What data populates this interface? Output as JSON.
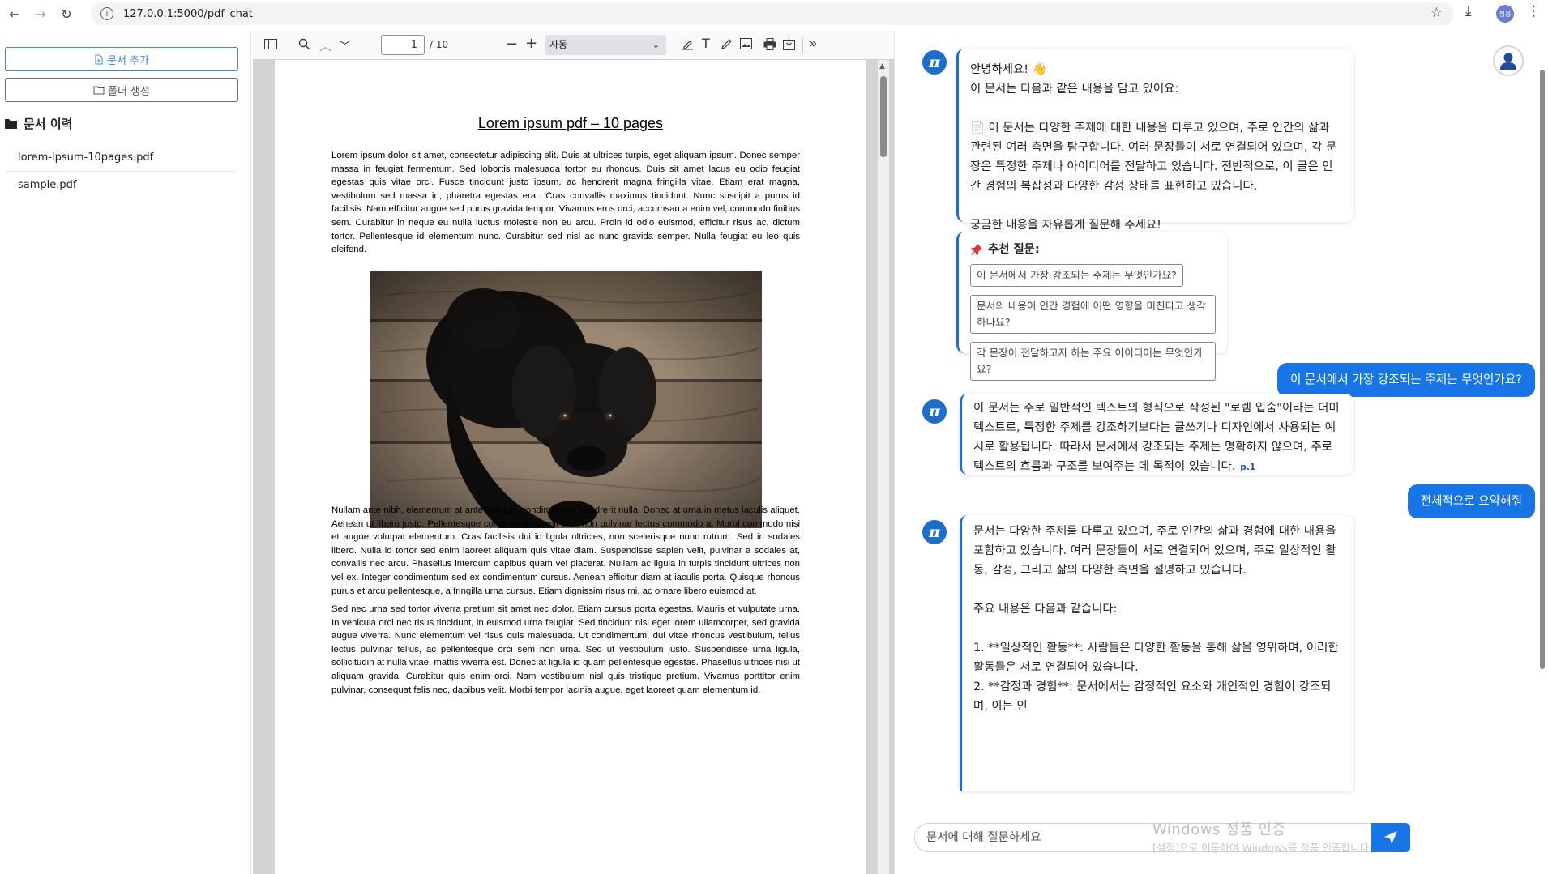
{
  "browser": {
    "url": "127.0.0.1:5000/pdf_chat",
    "profile_label": "정용"
  },
  "sidebar": {
    "add_doc_label": "문서 추가",
    "new_folder_label": "폴더 생성",
    "history_title": "문서 이력",
    "documents": [
      {
        "name": "lorem-ipsum-10pages.pdf"
      },
      {
        "name": "sample.pdf"
      }
    ]
  },
  "pdf_viewer": {
    "page_current": "1",
    "page_total": "/ 10",
    "zoom": "자동",
    "page": {
      "title": "Lorem ipsum pdf – 10 pages",
      "paragraph1": "Lorem ipsum dolor sit amet, consectetur adipiscing elit. Duis at ultrices turpis, eget aliquam ipsum. Donec semper massa in feugiat fermentum. Sed lobortis malesuada tortor eu rhoncus. Duis sit amet lacus eu odio feugiat egestas quis vitae orci. Fusce tincidunt justo ipsum, ac hendrerit magna fringilla vitae. Etiam erat magna, vestibulum sed massa in, pharetra egestas erat. Cras convallis maximus tincidunt. Nunc suscipit a purus id facilisis. Nam efficitur augue sed purus gravida tempor. Vivamus eros orci, accumsan a enim vel, commodo finibus sem. Curabitur in neque eu nulla luctus molestie non eu arcu. Proin id odio euismod, efficitur risus ac, dictum tortor. Pellentesque id elementum nunc. Curabitur sed nisl ac nunc gravida semper. Nulla feugiat eu leo quis eleifend.",
      "paragraph2": "Nullam ante nibh, elementum at ante congue, condimentum hendrerit nulla. Donec at urna in metus iaculis aliquet. Aenean ut libero justo. Pellentesque condimentum velit orci, non pulvinar lectus commodo a. Morbi commodo nisi et augue volutpat elementum. Cras facilisis dui id ligula ultricies, non scelerisque nunc rutrum. Sed in sodales libero. Nulla id tortor sed enim laoreet aliquam quis vitae diam. Suspendisse sapien velit, pulvinar a sodales at, convallis nec arcu. Phasellus interdum dapibus quam vel placerat. Nullam ac ligula in turpis tincidunt ultrices non vel ex. Integer condimentum sed ex condimentum cursus. Aenean efficitur diam at iaculis porta. Quisque rhoncus purus et arcu pellentesque, a fringilla urna cursus. Etiam dignissim risus mi, ac ornare libero euismod at.",
      "paragraph3": "Sed nec urna sed tortor viverra pretium sit amet nec dolor. Etiam cursus porta egestas. Mauris et vulputate urna. In vehicula orci nec risus tincidunt, in euismod urna feugiat. Sed tincidunt nisl eget lorem ullamcorper, sed gravida augue viverra. Nunc elementum vel risus quis malesuada. Ut condimentum, dui vitae rhoncus vestibulum, tellus lectus pulvinar tellus, ac pellentesque orci sem non urna. Sed ut vestibulum justo. Suspendisse urna ligula, sollicitudin at nulla vitae, mattis viverra est. Donec at ligula id quam pellentesque egestas. Phasellus ultrices nisi ut aliquam gravida. Curabitur quis enim orci. Nam vestibulum nisl quis tristique pretium. Vivamus porttitor enim pulvinar, consequat felis nec, dapibus velit. Morbi tempor lacinia augue, eget laoreet quam elementum id."
    }
  },
  "chat": {
    "greeting": {
      "line1": "안녕하세요! 👋",
      "line2": "이 문서는 다음과 같은 내용을 담고 있어요:",
      "summary": "📄 이 문서는 다양한 주제에 대한 내용을 다루고 있으며, 주로 인간의 삶과 관련된 여러 측면을 탐구합니다. 여러 문장들이 서로 연결되어 있으며, 각 문장은 특정한 주제나 아이디어를 전달하고 있습니다. 전반적으로, 이 글은 인간 경험의 복잡성과 다양한 감정 상태를 표현하고 있습니다.",
      "closing": "궁금한 내용을 자유롭게 질문해 주세요!"
    },
    "suggestions": {
      "title": "추천 질문:",
      "items": [
        "이 문서에서 가장 강조되는 주제는 무엇인가요?",
        "문서의 내용이 인간 경험에 어떤 영향을 미친다고 생각하나요?",
        "각 문장이 전달하고자 하는 주요 아이디어는 무엇인가요?"
      ]
    },
    "messages": {
      "user1": "이 문서에서 가장 강조되는 주제는 무엇인가요?",
      "bot1": "이 문서는 주로 일반적인 텍스트의 형식으로 작성된 \"로렘 입숨\"이라는 더미 텍스트로, 특정한 주제를 강조하기보다는 글쓰기나 디자인에서 사용되는 예시로 활용됩니다. 따라서 문서에서 강조되는 주제는 명확하지 않으며, 주로 텍스트의 흐름과 구조를 보여주는 데 목적이 있습니다.",
      "bot1_ref": "p.1",
      "user2": "전체적으로 요약해줘",
      "bot2_p1": "문서는 다양한 주제를 다루고 있으며, 주로 인간의 삶과 경험에 대한 내용을 포함하고 있습니다. 여러 문장들이 서로 연결되어 있으며, 주로 일상적인 활동, 감정, 그리고 삶의 다양한 측면을 설명하고 있습니다.",
      "bot2_p2": "주요 내용은 다음과 같습니다:",
      "bot2_p3": "1. **일상적인 활동**: 사람들은 다양한 활동을 통해 삶을 영위하며, 이러한 활동들은 서로 연결되어 있습니다.",
      "bot2_p4": "2. **감정과 경험**: 문서에서는 감정적인 요소와 개인적인 경험이 강조되며, 이는 인"
    },
    "input_placeholder": "문서에 대해 질문하세요",
    "watermark_line1": "Windows 정품 인증",
    "watermark_line2": "[설정]으로 이동하여 Windows를 정품 인증합니다."
  },
  "colors": {
    "accent": "#1875e6",
    "bot_accent": "#1f6dc8"
  }
}
